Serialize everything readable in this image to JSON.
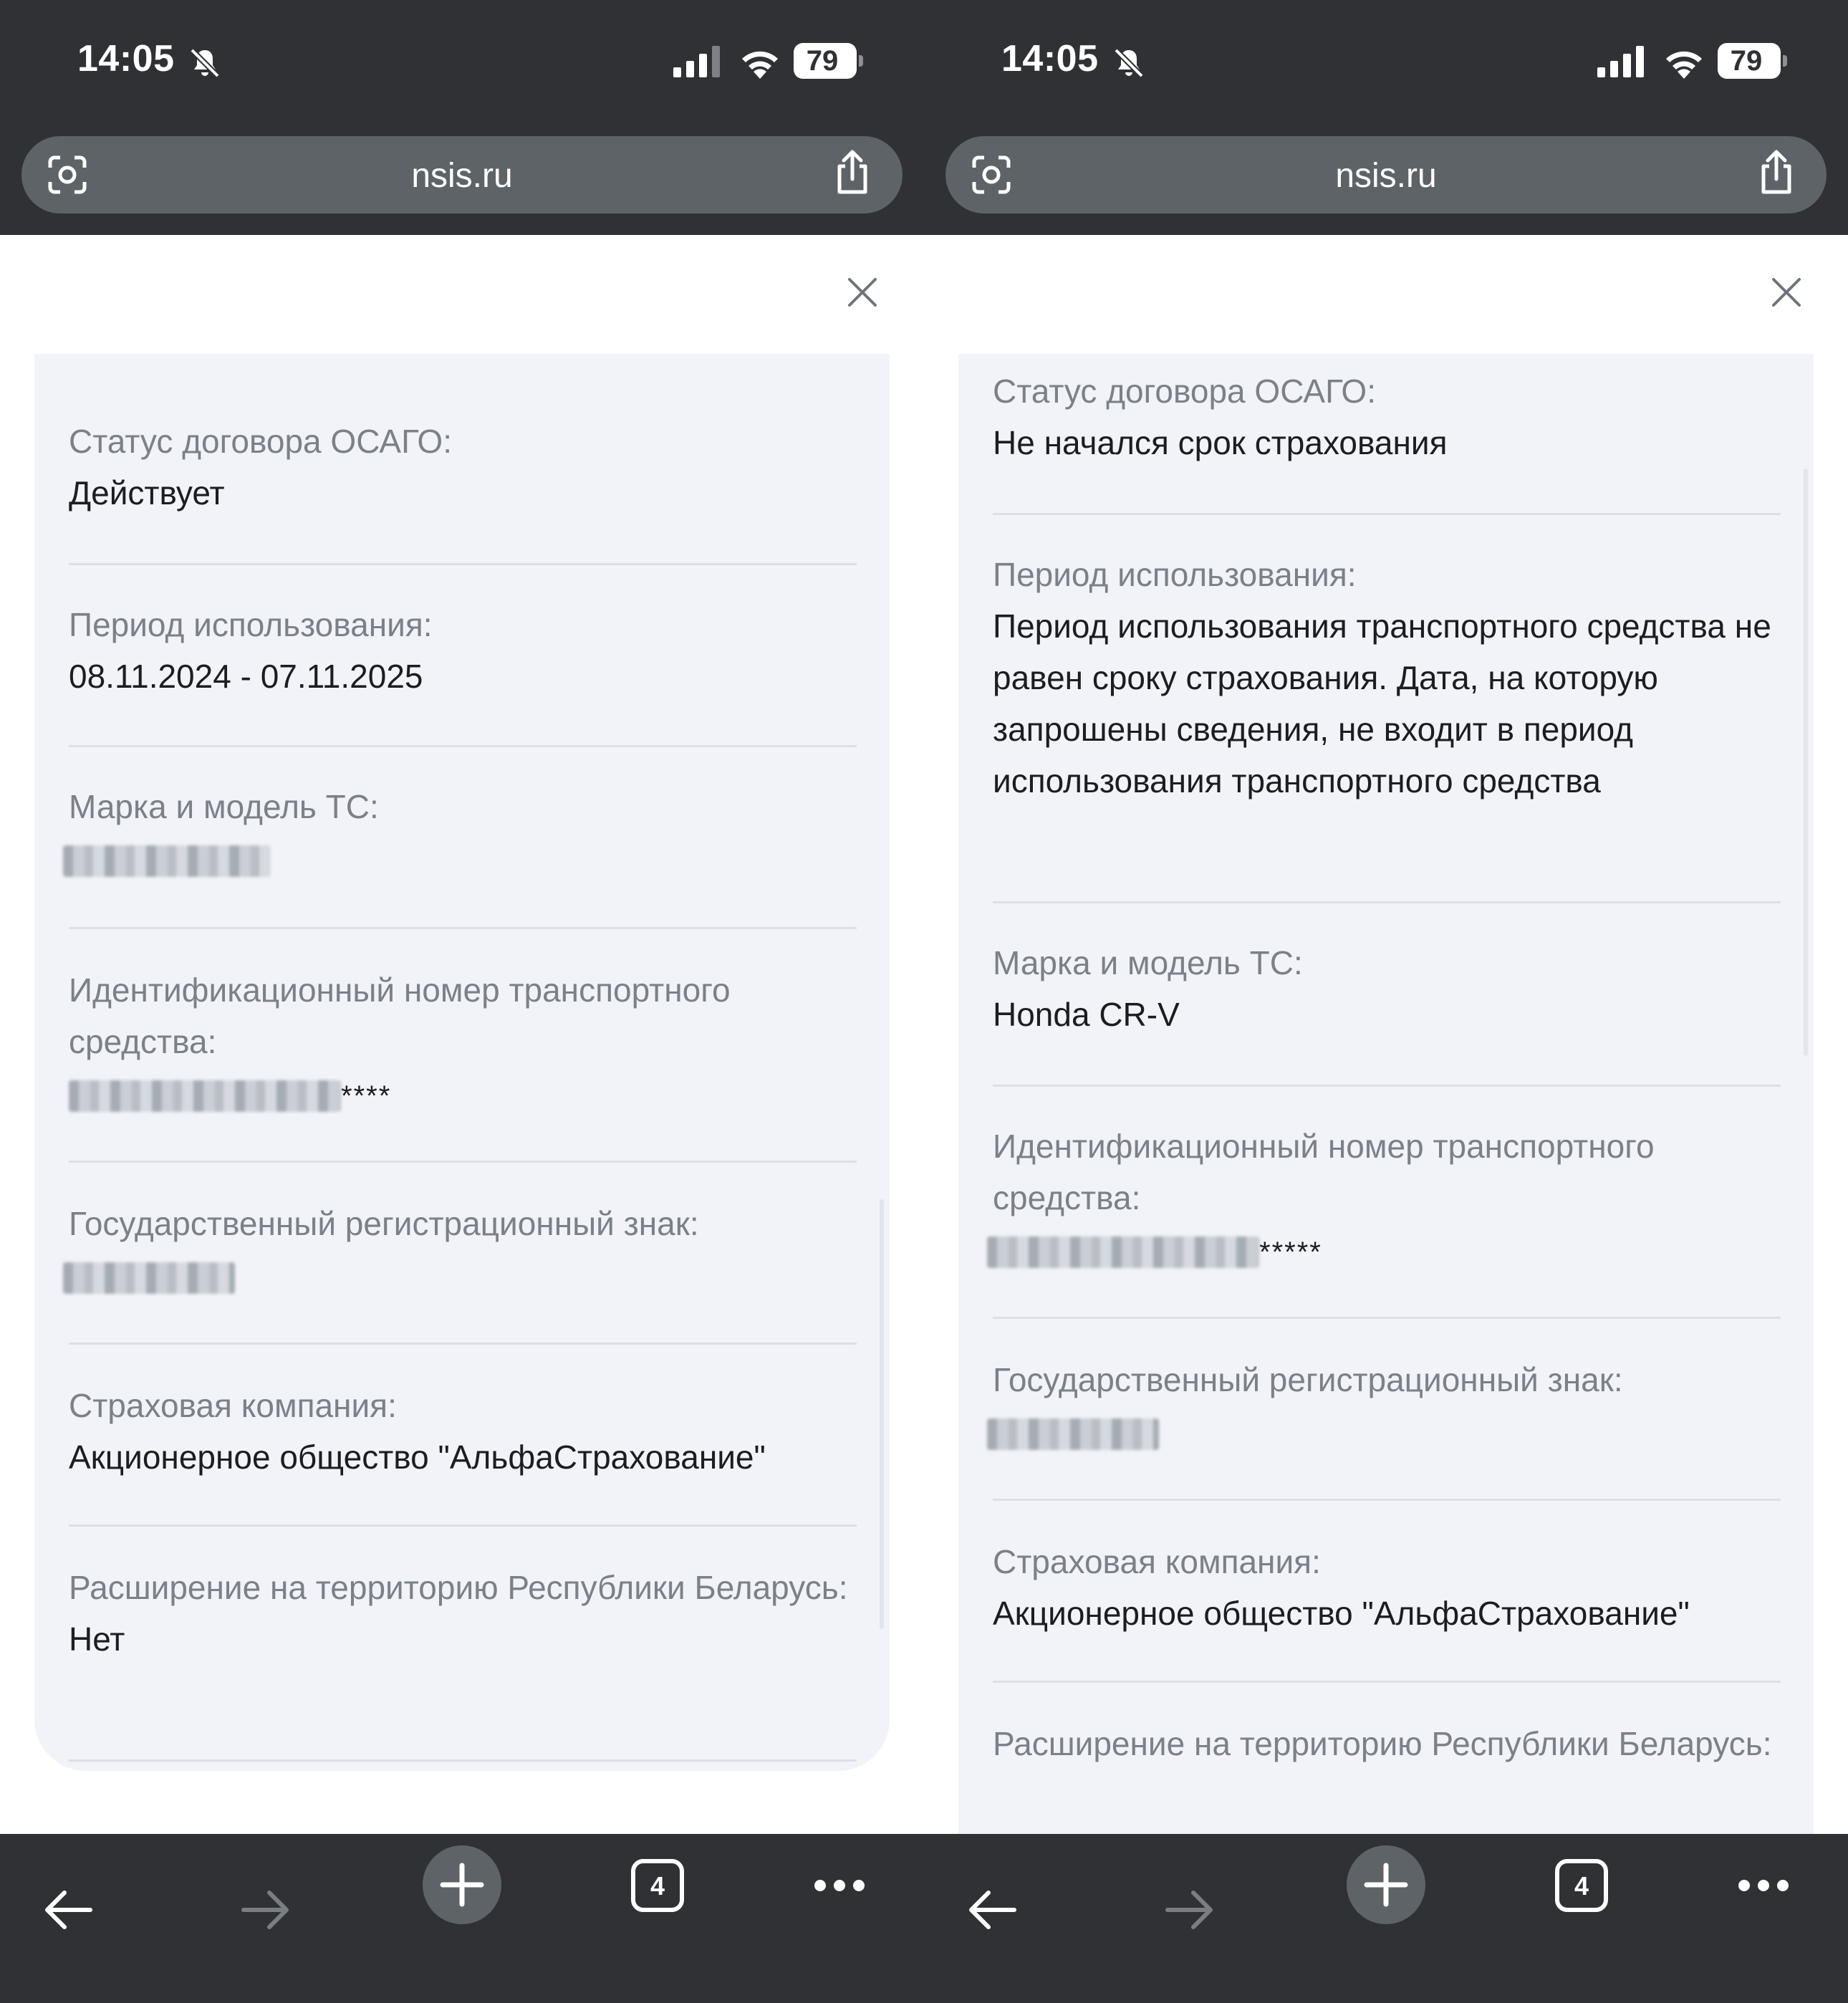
{
  "status_bar": {
    "time": "14:05",
    "battery": "79"
  },
  "browser": {
    "url": "nsis.ru",
    "tab_count": "4"
  },
  "left": {
    "fields": [
      {
        "label": "Статус договора ОСАГО:",
        "value": "Действует"
      },
      {
        "label": "Период использования:",
        "value": "08.11.2024 - 07.11.2025"
      },
      {
        "label": "Марка и модель ТС:",
        "value": ""
      },
      {
        "label": "Идентификационный номер транспортного средства:",
        "value_suffix": "****"
      },
      {
        "label": "Государственный регистрационный знак:",
        "value": ""
      },
      {
        "label": "Страховая компания:",
        "value": "Акционерное общество \"АльфаСтрахование\""
      },
      {
        "label": "Расширение на территорию Республики Беларусь:",
        "value": "Нет"
      }
    ]
  },
  "right": {
    "fields": [
      {
        "label": "Статус договора ОСАГО:",
        "value": "Не начался срок страхования"
      },
      {
        "label": "Период использования:",
        "value": "Период использования транспортного средства не равен сроку страхования. Дата, на которую запрошены сведения, не входит в период использования транспортного средства"
      },
      {
        "label": "Марка и модель ТС:",
        "value": "Honda CR-V"
      },
      {
        "label": "Идентификационный номер транспортного средства:",
        "value_suffix": "*****"
      },
      {
        "label": "Государственный регистрационный знак:",
        "value": ""
      },
      {
        "label": "Страховая компания:",
        "value": "Акционерное общество \"АльфаСтрахование\""
      },
      {
        "label": "Расширение на территорию Республики Беларусь:"
      }
    ]
  }
}
